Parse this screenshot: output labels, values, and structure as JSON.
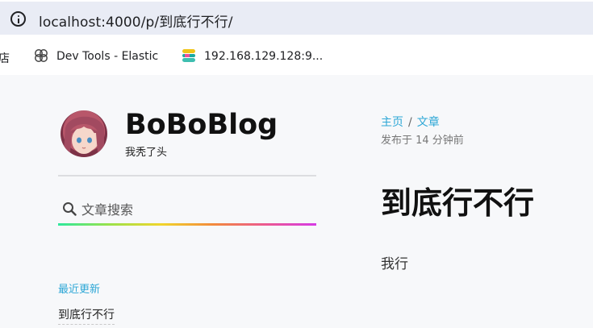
{
  "browser": {
    "url": "localhost:4000/p/到底行不行/",
    "bookmarks": [
      {
        "label": "店",
        "icon": "bookmark-icon"
      },
      {
        "label": "Dev Tools - Elastic",
        "icon": "elastic-devtools-icon"
      },
      {
        "label": "192.168.129.128:9...",
        "icon": "elastic-icon"
      }
    ]
  },
  "sidebar": {
    "blog_title": "BoBoBlog",
    "blog_subtitle": "我秃了头",
    "search_placeholder": "文章搜索",
    "recent_heading": "最近更新",
    "recent_items": [
      "到底行不行"
    ]
  },
  "article": {
    "breadcrumb": [
      "主页",
      "文章"
    ],
    "breadcrumb_sep": "/",
    "published": "发布于 14 分钟前",
    "title": "到底行不行",
    "body": "我行"
  },
  "colors": {
    "link": "#2ea7d6",
    "addressbar_bg": "#e9ecf5",
    "page_bg": "#f7f8fa"
  }
}
